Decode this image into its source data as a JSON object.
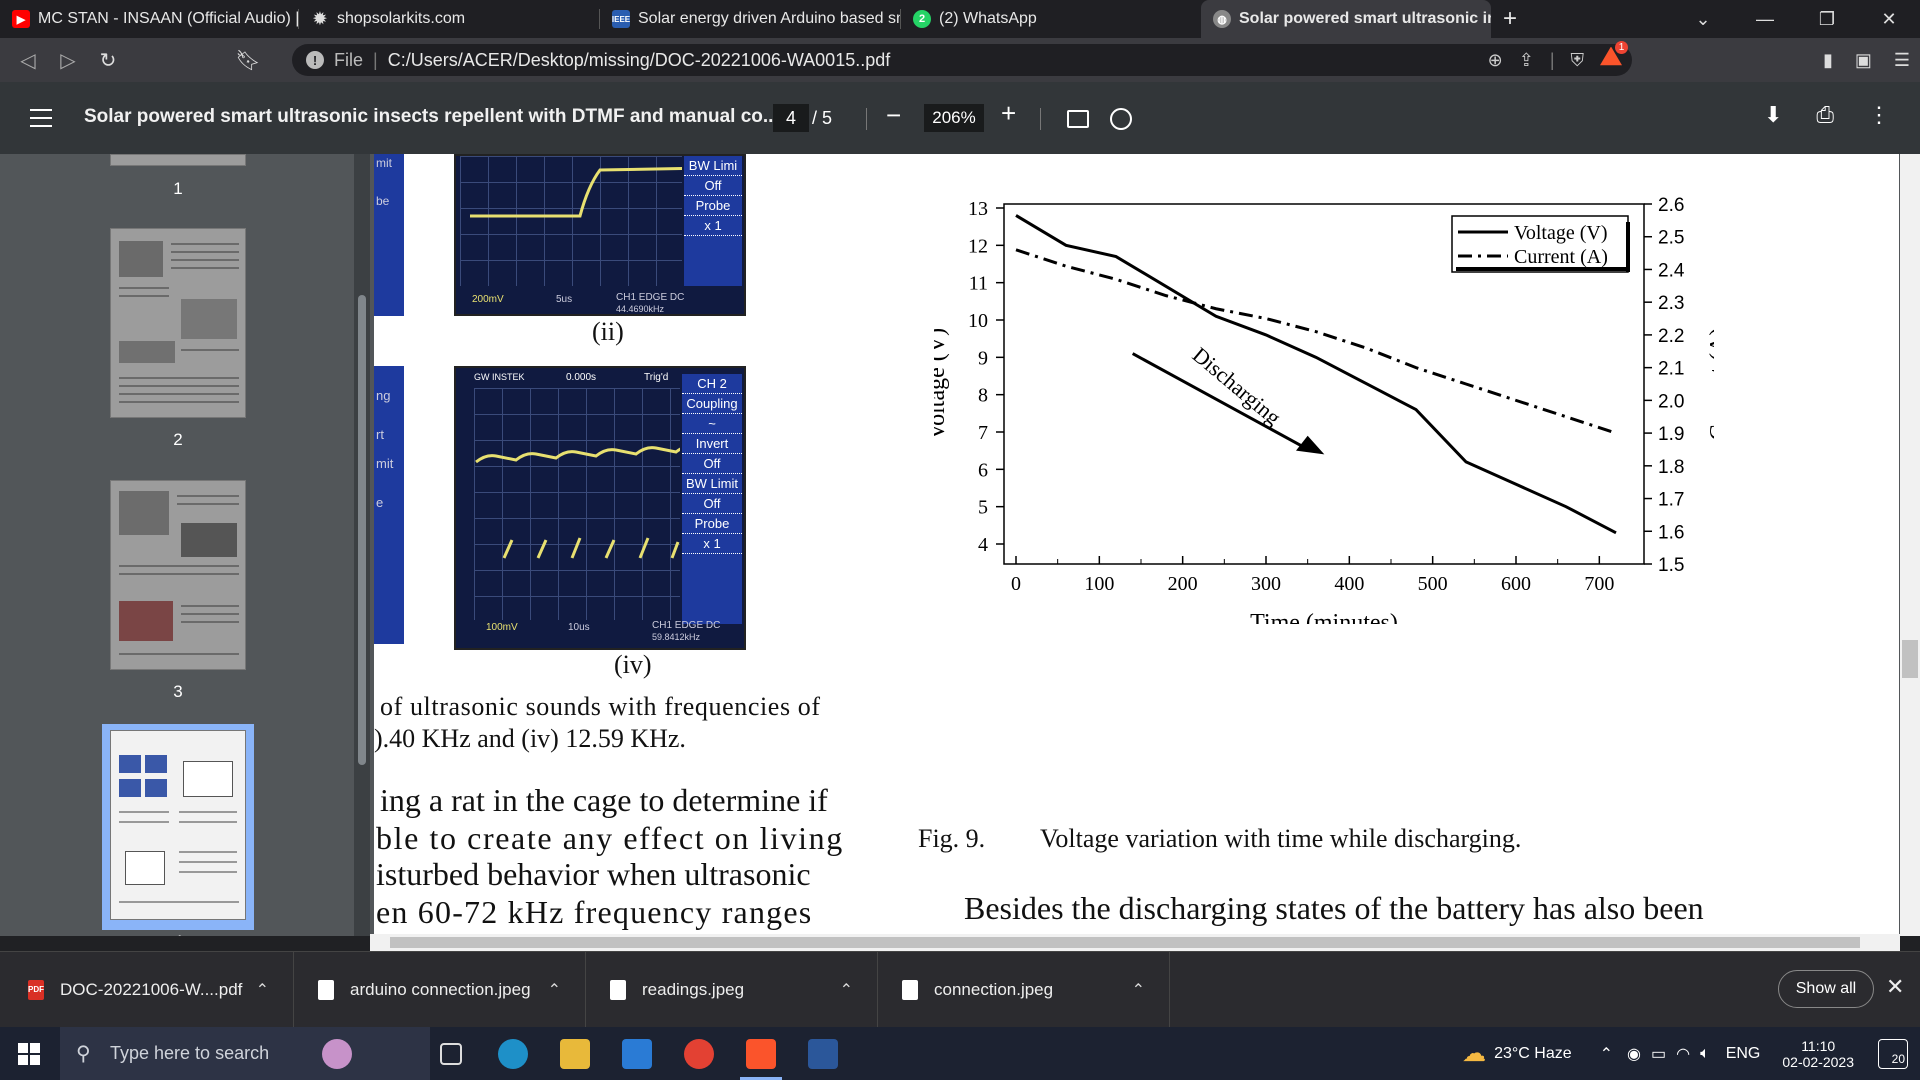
{
  "tabs": [
    {
      "title": "MC STAN - INSAAN (Official Audio) | I",
      "icon": "youtube-icon",
      "color": "#ff0000"
    },
    {
      "title": "shopsolarkits.com",
      "icon": "sun-icon",
      "color": "#dddddd"
    },
    {
      "title": "Solar energy driven Arduino based sm",
      "icon": "ieee-icon",
      "color": "#2a5db0"
    },
    {
      "title": "(2) WhatsApp",
      "icon": "whatsapp-icon",
      "color": "#25d366"
    },
    {
      "title": "Solar powered smart ultrasonic in",
      "icon": "globe-icon",
      "color": "#aaaaaa"
    }
  ],
  "address": {
    "prefix": "File",
    "url": "C:/Users/ACER/Desktop/missing/DOC-20221006-WA0015..pdf",
    "brave_badge": "1"
  },
  "pdf": {
    "title": "Solar powered smart ultrasonic insects repellent with DTMF and manual co...",
    "current_page": "4",
    "total_pages": "/ 5",
    "zoom": "206%"
  },
  "thumbnails": [
    {
      "label": "1"
    },
    {
      "label": "2"
    },
    {
      "label": "3"
    },
    {
      "label": "4"
    }
  ],
  "document": {
    "caption_ii": "(ii)",
    "caption_iv": "(iv)",
    "osc_ii": {
      "menu": [
        "BW Limi",
        "Off",
        "Probe",
        "x 1"
      ],
      "bottom_left": "200mV",
      "bottom_mid": "5us",
      "bottom_right": "CH1  EDGE  DC",
      "freq": "44.4690kHz"
    },
    "osc_iv": {
      "top_left": "GW INSTEK",
      "top_mid": "0.000s",
      "trig": "Trig'd",
      "menu": [
        "CH 2",
        "Coupling",
        "~",
        "Invert",
        "Off",
        "BW Limit",
        "Off",
        "Probe",
        "x 1"
      ],
      "bottom_left": "100mV",
      "bottom_mid": "10us",
      "bottom_right": "CH1  EDGE  DC",
      "freq": "59.8412kHz"
    },
    "left_frag": [
      "mit",
      "be",
      "ng",
      "rt",
      "mit",
      "e"
    ],
    "text_lines": [
      "of ultrasonic sounds with frequencies of",
      ").40 KHz and (iv) 12.59 KHz.",
      "ing a rat in the cage to determine if",
      "ble to create any effect on living",
      "isturbed behavior when ultrasonic",
      "en 60-72 kHz frequency ranges"
    ],
    "fig_label": "Fig. 9.",
    "fig_caption": "Voltage variation with time while discharging.",
    "body_line": "Besides the discharging states of the battery has also been"
  },
  "chart_data": {
    "type": "line",
    "xlabel": "Time (minutes)",
    "ylabel": "Voltage (V)",
    "y2label": "Current (A)",
    "xlim": [
      0,
      720
    ],
    "ylim": [
      4,
      13
    ],
    "y2lim": [
      1.5,
      2.6
    ],
    "xticks": [
      "0",
      "100",
      "200",
      "300",
      "400",
      "500",
      "600",
      "700"
    ],
    "yticks": [
      "13",
      "12",
      "11",
      "10",
      "9",
      "8",
      "7",
      "6",
      "5",
      "4"
    ],
    "y2ticks": [
      "2.6",
      "2.5",
      "2.4",
      "2.3",
      "2.2",
      "2.1",
      "2.0",
      "1.9",
      "1.8",
      "1.7",
      "1.6",
      "1.5"
    ],
    "annotation": "Discharging",
    "legend_position": "top-right",
    "series": [
      {
        "name": "Voltage (V)",
        "axis": "left",
        "style": "solid",
        "x": [
          0,
          60,
          120,
          240,
          300,
          360,
          420,
          480,
          540,
          600,
          660,
          720
        ],
        "y": [
          12.8,
          12.0,
          11.7,
          10.1,
          9.6,
          9.0,
          8.3,
          7.6,
          6.2,
          5.6,
          5.0,
          4.3
        ]
      },
      {
        "name": "Current (A)",
        "axis": "right",
        "style": "dashdot",
        "x": [
          0,
          60,
          120,
          180,
          240,
          300,
          360,
          420,
          480,
          540,
          600,
          660,
          720
        ],
        "y": [
          2.46,
          2.41,
          2.37,
          2.32,
          2.28,
          2.25,
          2.21,
          2.16,
          2.1,
          2.05,
          2.0,
          1.95,
          1.9
        ]
      }
    ]
  },
  "downloads": [
    {
      "name": "DOC-20221006-W....pdf",
      "type": "pdf"
    },
    {
      "name": "arduino connection.jpeg",
      "type": "image"
    },
    {
      "name": "readings.jpeg",
      "type": "image"
    },
    {
      "name": "connection.jpeg",
      "type": "image"
    }
  ],
  "downloads_show_all": "Show all",
  "taskbar": {
    "search_placeholder": "Type here to search",
    "weather": "23°C  Haze",
    "lang": "ENG",
    "time": "11:10",
    "date": "02-02-2023",
    "notifications": "20"
  }
}
